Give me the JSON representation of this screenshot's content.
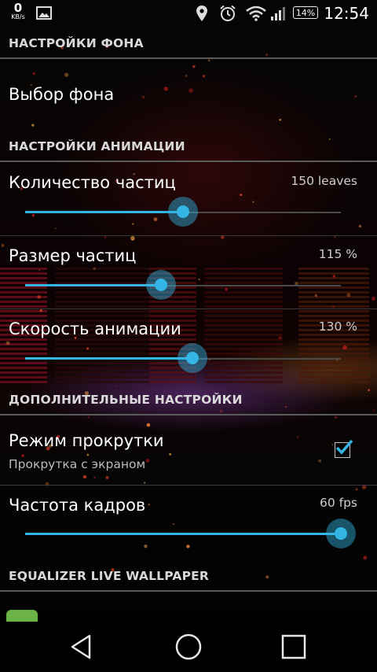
{
  "status_bar": {
    "net_speed_value": "0",
    "net_speed_unit": "KB/s",
    "battery": "14%",
    "time": "12:54",
    "left_icons": [
      "image-icon"
    ],
    "right_icons": [
      "location-icon",
      "alarm-icon",
      "wifi-icon",
      "signal-icon",
      "battery-icon"
    ]
  },
  "sections": {
    "background": {
      "header": "НАСТРОЙКИ ФОНА",
      "choose_background": "Выбор фона"
    },
    "animation": {
      "header": "НАСТРОЙКИ АНИМАЦИИ",
      "particle_count": {
        "title": "Количество частиц",
        "value": "150 leaves",
        "level": 0.5
      },
      "particle_size": {
        "title": "Размер частиц",
        "value": "115 %",
        "level": 0.43
      },
      "animation_speed": {
        "title": "Скорость анимации",
        "value": "130 %",
        "level": 0.53
      }
    },
    "additional": {
      "header": "ДОПОЛНИТЕЛЬНЫЕ НАСТРОЙКИ",
      "scroll_mode": {
        "title": "Режим прокрутки",
        "summary": "Прокрутка с экраном",
        "checked": true
      },
      "frame_rate": {
        "title": "Частота кадров",
        "value": "60 fps",
        "level": 1.0
      }
    },
    "equalizer": {
      "header": "EQUALIZER LIVE WALLPAPER"
    }
  },
  "colors": {
    "accent": "#33b5e5",
    "background": "#000000",
    "section_header_text": "#d9d9d9"
  },
  "navigation": {
    "icons": [
      "back-icon",
      "home-icon",
      "recent-apps-icon"
    ]
  }
}
